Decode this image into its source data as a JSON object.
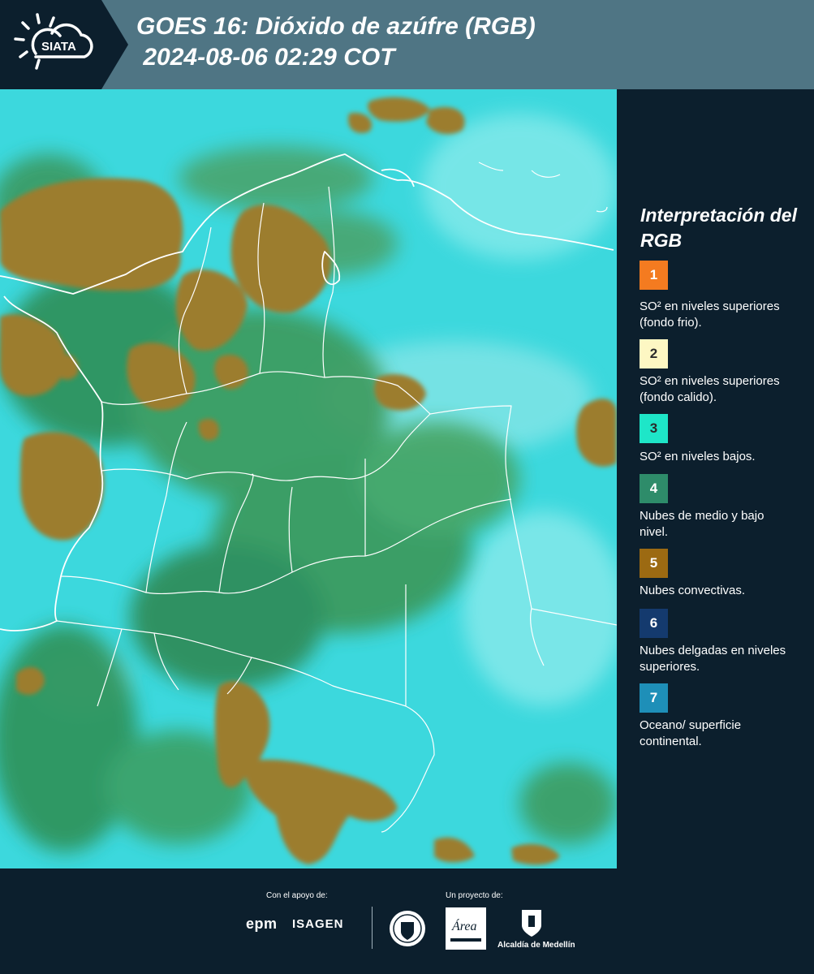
{
  "header": {
    "logo_text": "SIATA",
    "title_line1": "GOES 16: Dióxido de azúfre (RGB)",
    "title_line2": " 2024-08-06 02:29 COT"
  },
  "legend": {
    "heading": "Interpretación del RGB",
    "items": [
      {
        "number": "1",
        "color": "#f47b20",
        "label": "SO² en niveles superiores (fondo frio)."
      },
      {
        "number": "2",
        "color": "#fdf7c3",
        "label": "SO² en niveles superiores (fondo calido)."
      },
      {
        "number": "3",
        "color": "#1ee6c8",
        "label": "SO² en niveles bajos."
      },
      {
        "number": "4",
        "color": "#2e8c6a",
        "label": "Nubes de medio y bajo nivel."
      },
      {
        "number": "5",
        "color": "#9c6a12",
        "label": "Nubes convectivas."
      },
      {
        "number": "6",
        "color": "#143a6e",
        "label": "Nubes delgadas en niveles superiores."
      },
      {
        "number": "7",
        "color": "#1e8fb8",
        "label": "Oceano/ superficie continental."
      }
    ]
  },
  "footer": {
    "support_label": "Con el apoyo de:",
    "project_label": "Un proyecto de:",
    "sponsor_1": "epm",
    "sponsor_2": "ISAGEN",
    "partner_1_text": "Área",
    "partner_2": "Alcaldía de Medellín"
  },
  "map_colors": {
    "surface": "#37d6dc",
    "mid_low_clouds": "#2f8f58",
    "convective_clouds": "#9c7d2e",
    "borders": "#ffffff"
  }
}
